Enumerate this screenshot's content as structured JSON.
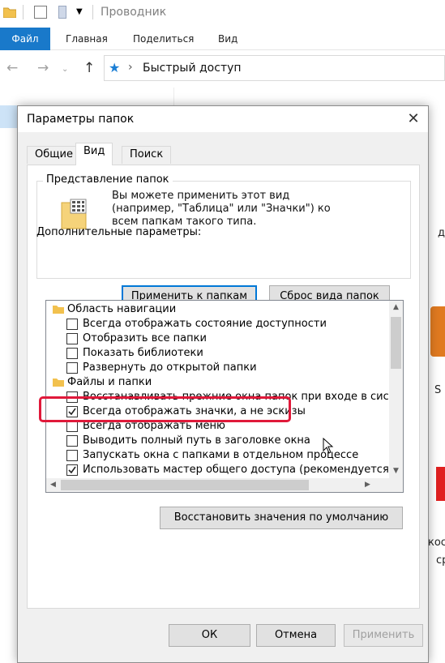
{
  "explorer": {
    "title": "Проводник",
    "ribbon_tabs": [
      "Файл",
      "Главная",
      "Поделиться",
      "Вид"
    ],
    "address": "Быстрый доступ",
    "bg_fragments": [
      "д",
      "S",
      "кос",
      "ср"
    ]
  },
  "dialog": {
    "title": "Параметры папок",
    "tabs": [
      "Общие",
      "Вид",
      "Поиск"
    ],
    "active_tab": "Вид",
    "folder_view": {
      "group_title": "Представление папок",
      "description": "Вы можете применить этот вид (например, \"Таблица\" или \"Значки\") ко всем папкам такого типа.",
      "apply_button": "Применить к папкам",
      "reset_button": "Сброс вида папок"
    },
    "advanced_label": "Дополнительные параметры:",
    "tree": [
      {
        "type": "category",
        "label": "Область навигации"
      },
      {
        "type": "checkbox",
        "label": "Всегда отображать состояние доступности",
        "checked": false
      },
      {
        "type": "checkbox",
        "label": "Отобразить все папки",
        "checked": false
      },
      {
        "type": "checkbox",
        "label": "Показать библиотеки",
        "checked": false
      },
      {
        "type": "checkbox",
        "label": "Развернуть до открытой папки",
        "checked": false
      },
      {
        "type": "category",
        "label": "Файлы и папки"
      },
      {
        "type": "checkbox",
        "label": "Восстанавливать прежние окна папок при входе в систе",
        "checked": false
      },
      {
        "type": "checkbox",
        "label": "Всегда отображать значки, а не эскизы",
        "checked": true
      },
      {
        "type": "checkbox",
        "label": "Всегда отображать меню",
        "checked": false
      },
      {
        "type": "checkbox",
        "label": "Выводить полный путь в заголовке окна",
        "checked": false
      },
      {
        "type": "checkbox",
        "label": "Запускать окна с папками в отдельном процессе",
        "checked": false
      },
      {
        "type": "checkbox",
        "label": "Использовать мастер общего доступа (рекомендуется)",
        "checked": true
      }
    ],
    "restore_defaults": "Восстановить значения по умолчанию",
    "ok": "ОК",
    "cancel": "Отмена",
    "apply": "Применить"
  },
  "colors": {
    "accent": "#0078d7",
    "file_tab": "#1979ca",
    "highlight": "#e0193a"
  }
}
